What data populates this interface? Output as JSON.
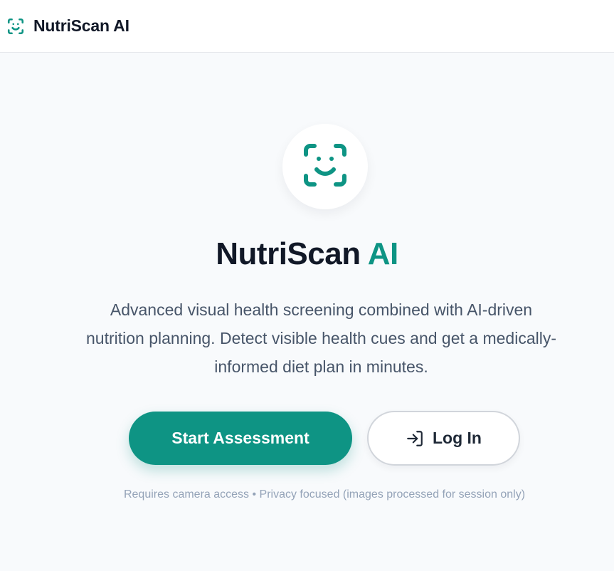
{
  "app": {
    "name": "NutriScan AI",
    "logo_icon": "face-scan-icon"
  },
  "hero": {
    "icon": "face-scan-icon",
    "title_main": "NutriScan",
    "title_accent": "AI",
    "description_lines": [
      "Advanced visual health screening combined with AI-driven",
      "nutrition planning. Detect visible health cues and get a medically-",
      "informed diet plan in minutes."
    ]
  },
  "actions": {
    "start_label": "Start Assessment",
    "login_label": "Log In",
    "login_icon": "log-in-icon"
  },
  "footnote": "Requires camera access • Privacy focused (images processed for session only)",
  "colors": {
    "accent": "#0e9484",
    "text_dark": "#111827",
    "text_muted": "#475569",
    "footnote": "#94a3b8",
    "background": "#f8fafc"
  }
}
